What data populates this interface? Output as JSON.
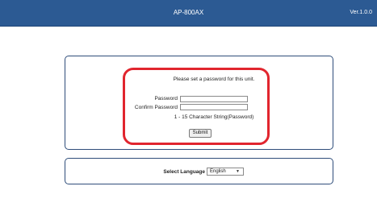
{
  "header": {
    "title": "AP-800AX",
    "version": "Ver.1.0.0",
    "color": "#2c5a93"
  },
  "setup": {
    "message": "Please set a password for this unit.",
    "password_label": "Password",
    "confirm_label": "Confirm Password",
    "password_value": "",
    "confirm_value": "",
    "hint": "1 - 15 Character String(Password)",
    "submit_label": "Submit",
    "highlight_color": "#e1252e"
  },
  "language": {
    "label": "Select Language",
    "selected": "English",
    "chevron_icon": "chevron-down-icon"
  }
}
